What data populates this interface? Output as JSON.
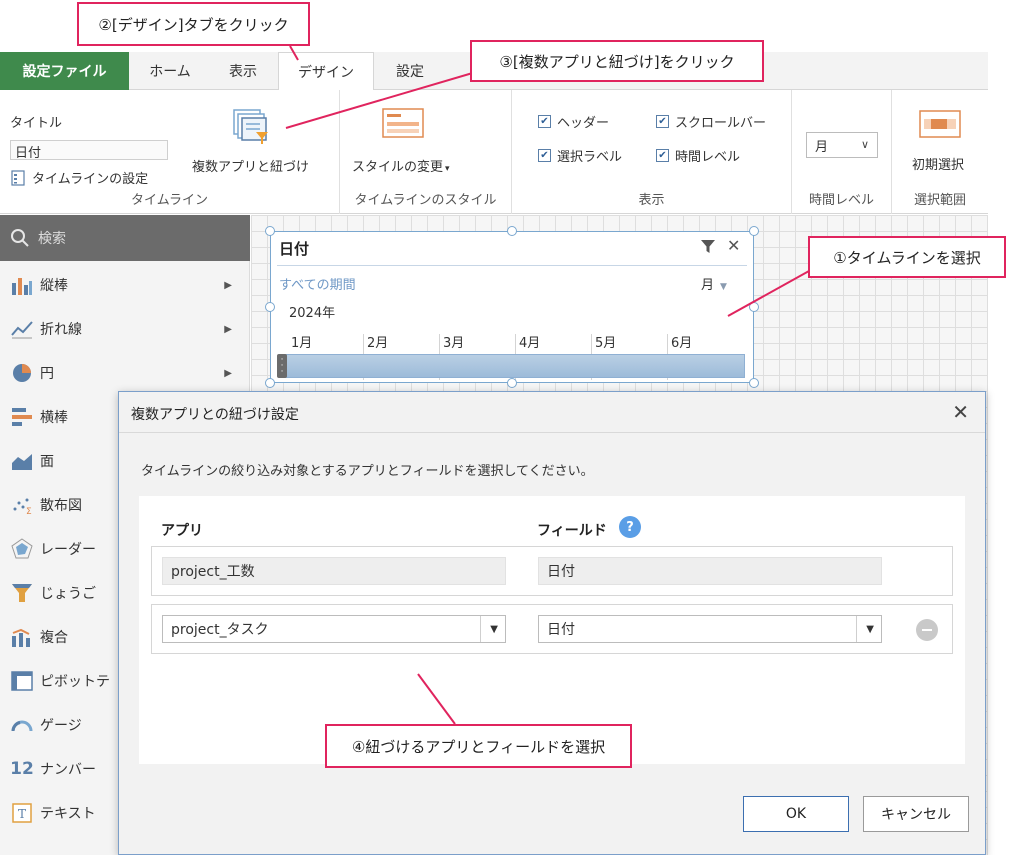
{
  "tabs": {
    "file": "設定ファイル",
    "home": "ホーム",
    "view": "表示",
    "design": "デザイン",
    "settings": "設定"
  },
  "ribbon": {
    "title_label": "タイトル",
    "title_value": "日付",
    "timeline_settings": "タイムラインの設定",
    "multi_app_link": "複数アプリと紐づけ",
    "group_timeline": "タイムライン",
    "change_style": "スタイルの変更",
    "group_style": "タイムラインのスタイル",
    "cb_header": "ヘッダー",
    "cb_scrollbar": "スクロールバー",
    "cb_selection_label": "選択ラベル",
    "cb_time_level": "時間レベル",
    "group_display": "表示",
    "time_level_value": "月",
    "group_time_level": "時間レベル",
    "initial_selection": "初期選択",
    "group_selection_range": "選択範囲"
  },
  "sidebar": {
    "search_placeholder": "検索",
    "items": [
      {
        "label": "縦棒"
      },
      {
        "label": "折れ線"
      },
      {
        "label": "円"
      },
      {
        "label": "横棒"
      },
      {
        "label": "面"
      },
      {
        "label": "散布図"
      },
      {
        "label": "レーダー"
      },
      {
        "label": "じょうご"
      },
      {
        "label": "複合"
      },
      {
        "label": "ピボットテ"
      },
      {
        "label": "ゲージ"
      },
      {
        "label": "ナンバー"
      },
      {
        "label": "テキスト"
      }
    ]
  },
  "timeline": {
    "title": "日付",
    "period": "すべての期間",
    "level": "月",
    "year": "2024年",
    "months": [
      "1月",
      "2月",
      "3月",
      "4月",
      "5月",
      "6月"
    ]
  },
  "dialog": {
    "title": "複数アプリとの紐づけ設定",
    "instruction": "タイムラインの絞り込み対象とするアプリとフィールドを選択してください。",
    "col_app": "アプリ",
    "col_field": "フィールド",
    "row1_app": "project_工数",
    "row1_field": "日付",
    "row2_app": "project_タスク",
    "row2_field": "日付",
    "ok": "OK",
    "cancel": "キャンセル"
  },
  "callouts": {
    "c1": "①タイムラインを選択",
    "c2": "②[デザイン]タブをクリック",
    "c3": "③[複数アプリと紐づけ]をクリック",
    "c4": "④紐づけるアプリとフィールドを選択"
  },
  "colors": {
    "file_tab": "#3f8a4c",
    "callout_border": "#e0245e",
    "accent_blue": "#7aa7cf"
  }
}
